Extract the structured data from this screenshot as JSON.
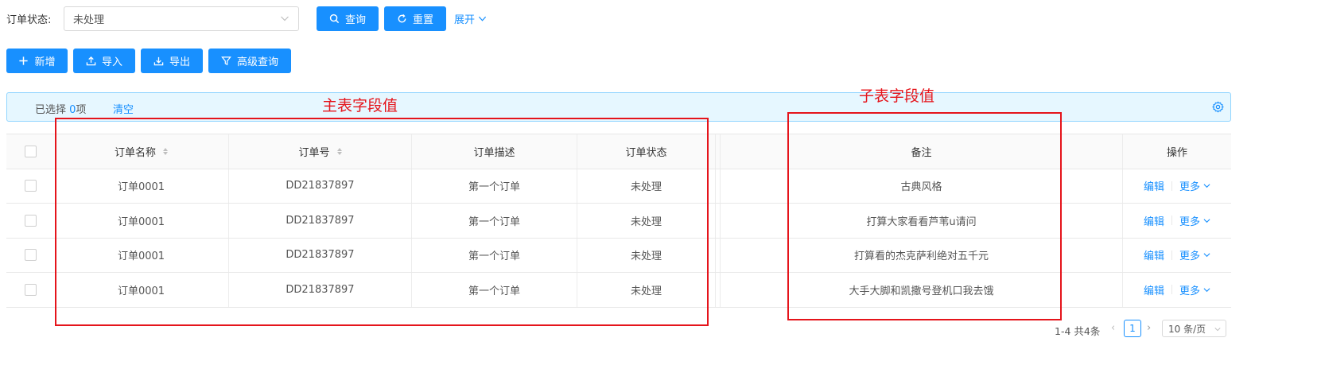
{
  "filter": {
    "label": "订单状态:",
    "value": "未处理",
    "search_label": "查询",
    "reset_label": "重置",
    "expand_label": "展开"
  },
  "toolbar": {
    "add_label": "新增",
    "import_label": "导入",
    "export_label": "导出",
    "advanced_label": "高级查询"
  },
  "selection": {
    "prefix": "已选择 ",
    "count": "0",
    "suffix": "项",
    "clear_label": "清空"
  },
  "table": {
    "columns": [
      "订单名称",
      "订单号",
      "订单描述",
      "订单状态",
      "备注",
      "操作"
    ],
    "rows": [
      {
        "name": "订单0001",
        "order_no": "DD21837897",
        "desc": "第一个订单",
        "status": "未处理",
        "remark": "古典风格"
      },
      {
        "name": "订单0001",
        "order_no": "DD21837897",
        "desc": "第一个订单",
        "status": "未处理",
        "remark": "打算大家看看芦苇u请问"
      },
      {
        "name": "订单0001",
        "order_no": "DD21837897",
        "desc": "第一个订单",
        "status": "未处理",
        "remark": "打算看的杰克萨利绝对五千元"
      },
      {
        "name": "订单0001",
        "order_no": "DD21837897",
        "desc": "第一个订单",
        "status": "未处理",
        "remark": "大手大脚和凯撒号登机口我去饿"
      }
    ],
    "edit_label": "编辑",
    "more_label": "更多"
  },
  "annotations": {
    "main_label": "主表字段值",
    "sub_label": "子表字段值",
    "color": "#e5141b"
  },
  "pagination": {
    "total": "1-4 共4条",
    "current_page": "1",
    "page_size": "10 条/页"
  },
  "colors": {
    "primary": "#1890ff",
    "info_bg": "#e6f7ff"
  }
}
